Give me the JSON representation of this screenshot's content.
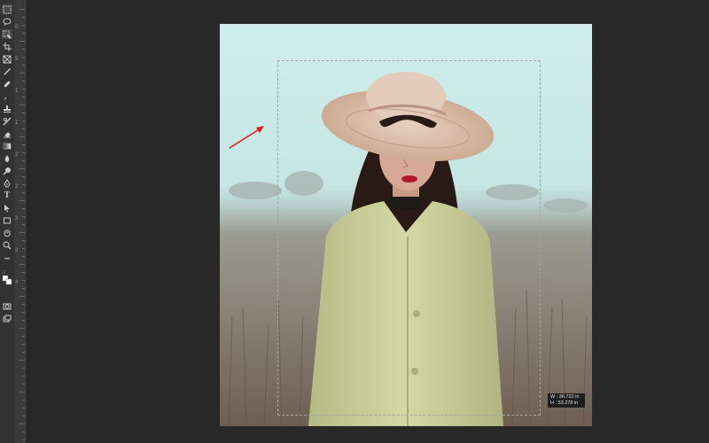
{
  "tools": [
    {
      "name": "marquee-tool",
      "icon": "marquee-icon"
    },
    {
      "name": "lasso-tool",
      "icon": "lasso-icon"
    },
    {
      "name": "object-select-tool",
      "icon": "object-select-icon"
    },
    {
      "name": "crop-tool",
      "icon": "crop-icon"
    },
    {
      "name": "frame-tool",
      "icon": "frame-icon"
    },
    {
      "name": "eyedropper-tool",
      "icon": "eyedropper-icon"
    },
    {
      "name": "healing-brush-tool",
      "icon": "healing-brush-icon"
    },
    {
      "name": "brush-tool",
      "icon": "brush-icon"
    },
    {
      "name": "clone-stamp-tool",
      "icon": "clone-stamp-icon"
    },
    {
      "name": "history-brush-tool",
      "icon": "history-brush-icon"
    },
    {
      "name": "eraser-tool",
      "icon": "eraser-icon"
    },
    {
      "name": "gradient-tool",
      "icon": "gradient-icon"
    },
    {
      "name": "blur-tool",
      "icon": "blur-icon"
    },
    {
      "name": "dodge-tool",
      "icon": "dodge-icon"
    },
    {
      "name": "pen-tool",
      "icon": "pen-icon"
    },
    {
      "name": "type-tool",
      "icon": "type-icon",
      "glyph": "T"
    },
    {
      "name": "path-select-tool",
      "icon": "path-select-icon"
    },
    {
      "name": "rectangle-tool",
      "icon": "rectangle-icon"
    },
    {
      "name": "hand-tool",
      "icon": "hand-icon"
    },
    {
      "name": "zoom-tool",
      "icon": "zoom-icon"
    },
    {
      "name": "more-tools",
      "icon": "ellipsis-icon",
      "glyph": "•••"
    },
    {
      "name": "color-swatches",
      "icon": "swatch-icon"
    },
    {
      "name": "quick-mask",
      "icon": "quick-mask-icon"
    },
    {
      "name": "screen-mode",
      "icon": "screen-mode-icon"
    }
  ],
  "ruler": {
    "labels": [
      "0",
      "5",
      "1",
      "1",
      "2",
      "2",
      "3",
      "3",
      "4"
    ]
  },
  "selection_info": {
    "width_label": "W :",
    "width_value": "36.722 in",
    "height_label": "H :",
    "height_value": "53.278 in"
  },
  "colors": {
    "annotation_arrow": "#e01e1e",
    "sky": "#c8e8e5",
    "field": "#7a6a5a",
    "coat": "#c9cf9a",
    "hat": "#d8b9a4"
  }
}
